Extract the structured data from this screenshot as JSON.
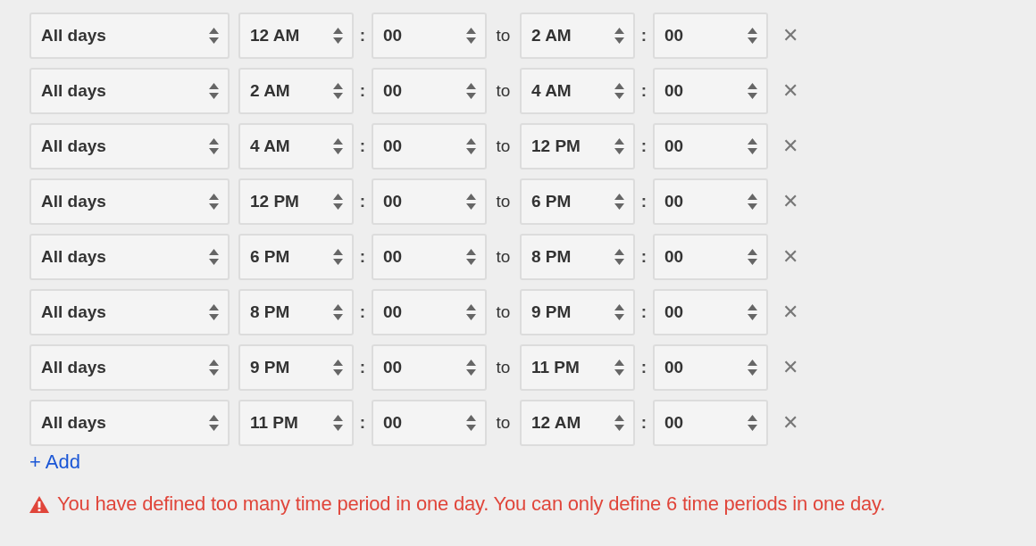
{
  "periods": [
    {
      "days": "All days",
      "from_hour": "12 AM",
      "from_minute": "00",
      "separator": "to",
      "to_hour": "2 AM",
      "to_minute": "00",
      "remove": "✕"
    },
    {
      "days": "All days",
      "from_hour": "2 AM",
      "from_minute": "00",
      "separator": "to",
      "to_hour": "4 AM",
      "to_minute": "00",
      "remove": "✕"
    },
    {
      "days": "All days",
      "from_hour": "4 AM",
      "from_minute": "00",
      "separator": "to",
      "to_hour": "12 PM",
      "to_minute": "00",
      "remove": "✕"
    },
    {
      "days": "All days",
      "from_hour": "12 PM",
      "from_minute": "00",
      "separator": "to",
      "to_hour": "6 PM",
      "to_minute": "00",
      "remove": "✕"
    },
    {
      "days": "All days",
      "from_hour": "6 PM",
      "from_minute": "00",
      "separator": "to",
      "to_hour": "8 PM",
      "to_minute": "00",
      "remove": "✕"
    },
    {
      "days": "All days",
      "from_hour": "8 PM",
      "from_minute": "00",
      "separator": "to",
      "to_hour": "9 PM",
      "to_minute": "00",
      "remove": "✕"
    },
    {
      "days": "All days",
      "from_hour": "9 PM",
      "from_minute": "00",
      "separator": "to",
      "to_hour": "11 PM",
      "to_minute": "00",
      "remove": "✕"
    },
    {
      "days": "All days",
      "from_hour": "11 PM",
      "from_minute": "00",
      "separator": "to",
      "to_hour": "12 AM",
      "to_minute": "00",
      "remove": "✕"
    }
  ],
  "time_separator": ":",
  "add_link": "+ Add",
  "error": {
    "message": "You have defined too many time period in one day. You can only define 6 time periods in one day."
  }
}
